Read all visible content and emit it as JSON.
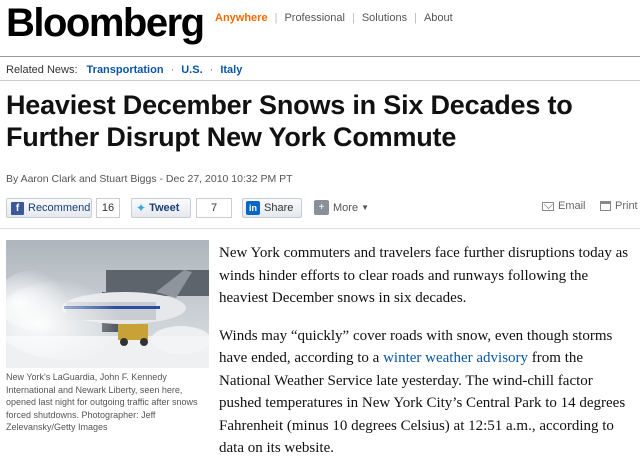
{
  "header": {
    "logo": "Bloomberg",
    "nav": [
      "Anywhere",
      "Professional",
      "Solutions",
      "About"
    ]
  },
  "related": {
    "label": "Related News:",
    "links": [
      "Transportation",
      "U.S.",
      "Italy"
    ]
  },
  "article": {
    "headline": "Heaviest December Snows in Six Decades to Further Disrupt New York Commute",
    "byline": "By Aaron Clark and Stuart Biggs - Dec 27, 2010 10:32 PM PT",
    "p1": "New York commuters and travelers face further disruptions today as winds hinder efforts to clear roads and runways following the heaviest December snows in six decades.",
    "p2_before": "Winds may “quickly” cover roads with snow, even though storms have ended, according to a ",
    "p2_link": "winter weather advisory",
    "p2_after": " from the National Weather Service late yesterday. The wind-chill factor pushed temperatures in New York City’s Central Park to 14 degrees Fahrenheit (minus 10 degrees Celsius) at 12:51 a.m., according to data on its website."
  },
  "share": {
    "recommend_label": "Recommend",
    "recommend_count": "16",
    "tweet_label": "Tweet",
    "tweet_count": "7",
    "linkedin_label": "Share",
    "more_label": "More",
    "email_label": "Email",
    "print_label": "Print"
  },
  "photo": {
    "caption": "New York's LaGuardia, John F. Kennedy International and Newark Liberty, seen here, opened last night for outgoing traffic after snows forced shutdowns. Photographer: Jeff Zelevansky/Getty Images"
  },
  "colors": {
    "accent": "#f06a00",
    "link": "#0b56a4"
  }
}
